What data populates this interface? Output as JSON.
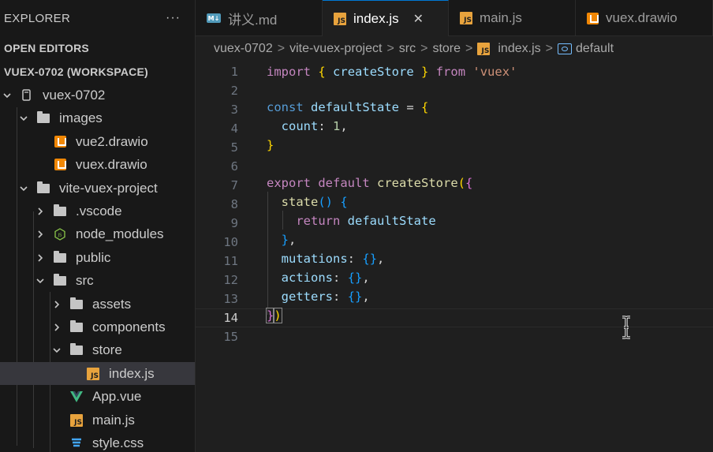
{
  "sidebar": {
    "title": "EXPLORER",
    "more": "···",
    "open_editors": "OPEN EDITORS",
    "workspace": "VUEX-0702 (WORKSPACE)",
    "tree": [
      {
        "label": "vuex-0702",
        "type": "root",
        "twisty": "down"
      },
      {
        "label": "images",
        "type": "folder",
        "twisty": "down"
      },
      {
        "label": "vue2.drawio",
        "type": "drawio"
      },
      {
        "label": "vuex.drawio",
        "type": "drawio"
      },
      {
        "label": "vite-vuex-project",
        "type": "folder",
        "twisty": "down"
      },
      {
        "label": ".vscode",
        "type": "folder",
        "twisty": "right"
      },
      {
        "label": "node_modules",
        "type": "node",
        "twisty": "right"
      },
      {
        "label": "public",
        "type": "folder",
        "twisty": "right"
      },
      {
        "label": "src",
        "type": "folder",
        "twisty": "down"
      },
      {
        "label": "assets",
        "type": "folder",
        "twisty": "right"
      },
      {
        "label": "components",
        "type": "folder",
        "twisty": "right"
      },
      {
        "label": "store",
        "type": "folder",
        "twisty": "down"
      },
      {
        "label": "index.js",
        "type": "js",
        "active": true
      },
      {
        "label": "App.vue",
        "type": "vue"
      },
      {
        "label": "main.js",
        "type": "js"
      },
      {
        "label": "style.css",
        "type": "css"
      }
    ]
  },
  "tabs": [
    {
      "label": "讲义.md",
      "icon": "markdown-icon",
      "icon_text": "M↓"
    },
    {
      "label": "index.js",
      "icon": "js-icon",
      "icon_text": "JS",
      "active": true,
      "close": "✕"
    },
    {
      "label": "main.js",
      "icon": "js-icon",
      "icon_text": "JS"
    },
    {
      "label": "vuex.drawio",
      "icon": "drawio-icon"
    }
  ],
  "breadcrumb": {
    "items": [
      "vuex-0702",
      "vite-vuex-project",
      "src",
      "store",
      "index.js",
      "default"
    ],
    "separator": ">",
    "js_icon_text": "JS"
  },
  "editor": {
    "current_line": 14,
    "line_numbers": [
      "1",
      "2",
      "3",
      "4",
      "5",
      "6",
      "7",
      "8",
      "9",
      "10",
      "11",
      "12",
      "13",
      "14",
      "15"
    ]
  },
  "colors": {
    "accent": "#0078d4",
    "keyword": "#c586c0",
    "storage": "#569cd6",
    "variable": "#9cdcfe",
    "function": "#dcdcaa",
    "string": "#ce9178",
    "number": "#b5cea8",
    "js_badge": "#e8a33d",
    "drawio": "#f08705"
  }
}
